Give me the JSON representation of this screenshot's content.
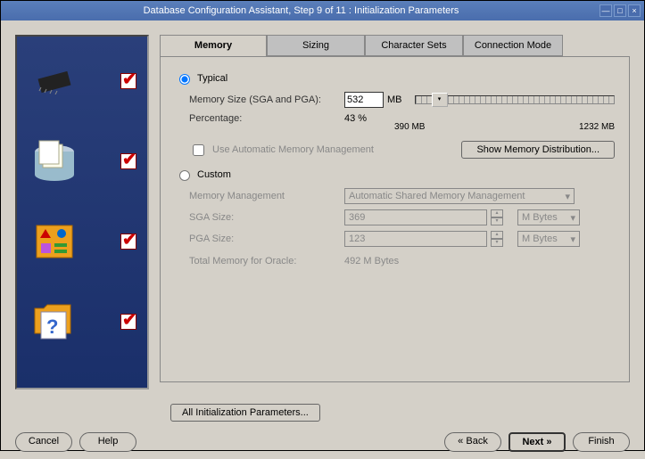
{
  "window": {
    "title": "Database Configuration Assistant, Step 9 of 11 : Initialization Parameters"
  },
  "tabs": {
    "memory": "Memory",
    "sizing": "Sizing",
    "charsets": "Character Sets",
    "connmode": "Connection Mode"
  },
  "typical": {
    "label": "Typical",
    "mem_label": "Memory Size (SGA and PGA):",
    "mem_value": "532",
    "mem_unit": "MB",
    "pct_label": "Percentage:",
    "pct_value": "43 %",
    "slider_min": "390 MB",
    "slider_max": "1232 MB",
    "auto_mm": "Use Automatic Memory Management",
    "show_dist": "Show Memory Distribution..."
  },
  "custom": {
    "label": "Custom",
    "mm_label": "Memory Management",
    "mm_value": "Automatic Shared Memory Management",
    "sga_label": "SGA Size:",
    "sga_value": "369",
    "pga_label": "PGA Size:",
    "pga_value": "123",
    "unit": "M Bytes",
    "total_label": "Total Memory for Oracle:",
    "total_value": "492 M Bytes"
  },
  "all_params": "All Initialization Parameters...",
  "buttons": {
    "cancel": "Cancel",
    "help": "Help",
    "back": "Back",
    "next": "Next",
    "finish": "Finish"
  }
}
